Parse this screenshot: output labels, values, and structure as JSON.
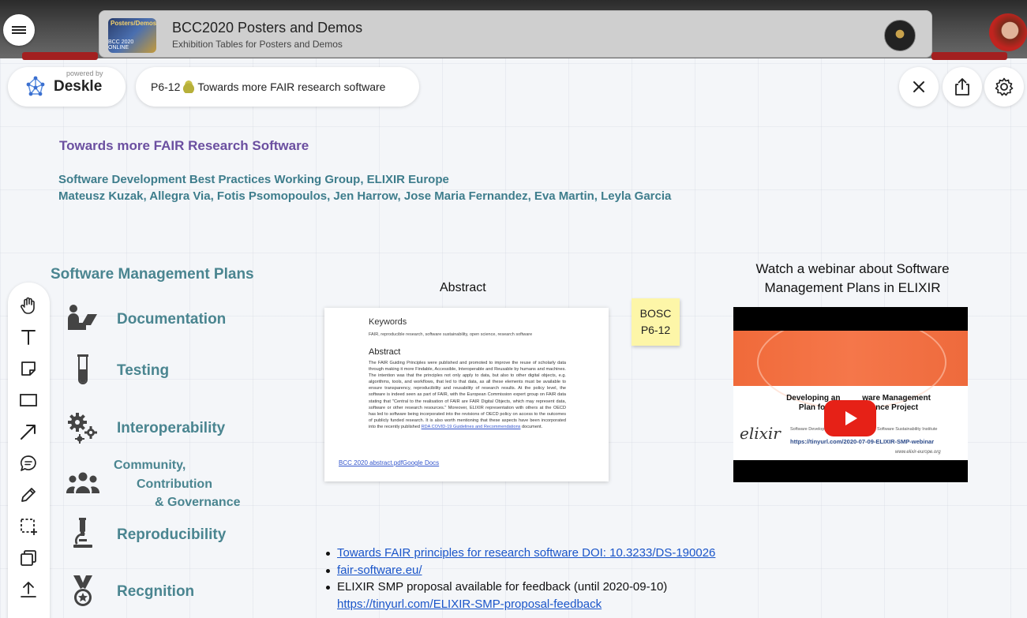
{
  "room": {
    "title": "BCC2020 Posters and Demos",
    "subtitle": "Exhibition Tables for Posters and Demos",
    "thumb_top": "Posters/Demos",
    "thumb_bottom": "BCC 2020 ONLINE"
  },
  "header": {
    "powered_by": "powered by",
    "brand": "Deskle",
    "poster_id": "P6-12",
    "poster_title": "Towards more FAIR research software"
  },
  "poster": {
    "title": "Towards more FAIR Research Software",
    "group": "Software Development Best Practices Working Group, ELIXIR Europe",
    "authors": "Mateusz Kuzak, Allegra Via, Fotis Psomopoulos, Jen Harrow, Jose Maria Fernandez, Eva Martin, Leyla Garcia",
    "smp_heading": "Software Management Plans",
    "features": {
      "documentation": "Documentation",
      "testing": "Testing",
      "interoperability": "Interoperability",
      "community_1": "Community,",
      "community_2": "Contribution",
      "community_3": "& Governance",
      "reproducibility": "Reproducibility",
      "recognition": "Recgnition"
    }
  },
  "abstract": {
    "label": "Abstract",
    "keywords_heading": "Keywords",
    "keywords": "FAIR, reproducible research, software sustainability, open science, research software",
    "heading": "Abstract",
    "body": "The FAIR Guiding Principles were published and promoted to improve the reuse of scholarly data through making it more Findable, Accessible, Interoperable and Reusable by humans and machines. The intention was that the principles not only apply to data, but also to other digital objects, e.g. algorithms, tools, and workflows, that led to that data, as all these elements must be available to ensure transparency, reproducibility and reusability of research results. At the policy level, the software is indeed seen as part of FAIR, with the European Commission expert group on FAIR data stating that \"Central to the realisation of FAIR are FAIR Digital Objects, which may represent data, software or other research resources.\" Moreover, ELIXIR representation with others at the OECD has led to software being incorporated into the revisions of OECD policy on access to the outcomes of publicly funded research. It is also worth mentioning that these aspects have been incorporated into the recently published",
    "body_link": "RDA COVID-19 Guidelines and Recommendations",
    "body_end": " document.",
    "file_link": "BCC 2020 abstract.pdfGoogle Docs"
  },
  "sticky": {
    "line1": "BOSC",
    "line2": "P6-12"
  },
  "webinar": {
    "label": "Watch a webinar about Software Management Plans in ELIXIR",
    "slide_title_1": "Developing an          ware Management",
    "slide_title_2": "Plan for          fe Science Project",
    "logo": "elixir",
    "small": "Software Development Best Practices WG & Software Sustainability Institute",
    "url": "https://tinyurl.com/2020-07-09-ELIXIR-SMP-webinar",
    "site": "www.elixir-europe.org"
  },
  "links": {
    "item1": "Towards FAIR principles for research software DOI: 10.3233/DS-190026",
    "item2": "fair-software.eu/",
    "item3": "ELIXIR SMP proposal available for feedback (until 2020-09-10)",
    "item3_link": "https://tinyurl.com/ELIXIR-SMP-proposal-feedback"
  },
  "colors": {
    "title_purple": "#6b4fa0",
    "teal": "#4a8590",
    "link_blue": "#1a55c9",
    "sticky_yellow": "#fdf6a8",
    "youtube_red": "#e62117"
  },
  "icons": {
    "menu": "hamburger-icon",
    "close": "close-icon",
    "share": "share-icon",
    "settings": "gear-icon",
    "tools": [
      "hand-icon",
      "text-icon",
      "sticky-note-icon",
      "rectangle-icon",
      "arrow-icon",
      "comment-icon",
      "pencil-icon",
      "selection-icon",
      "layers-icon",
      "upload-icon"
    ]
  }
}
